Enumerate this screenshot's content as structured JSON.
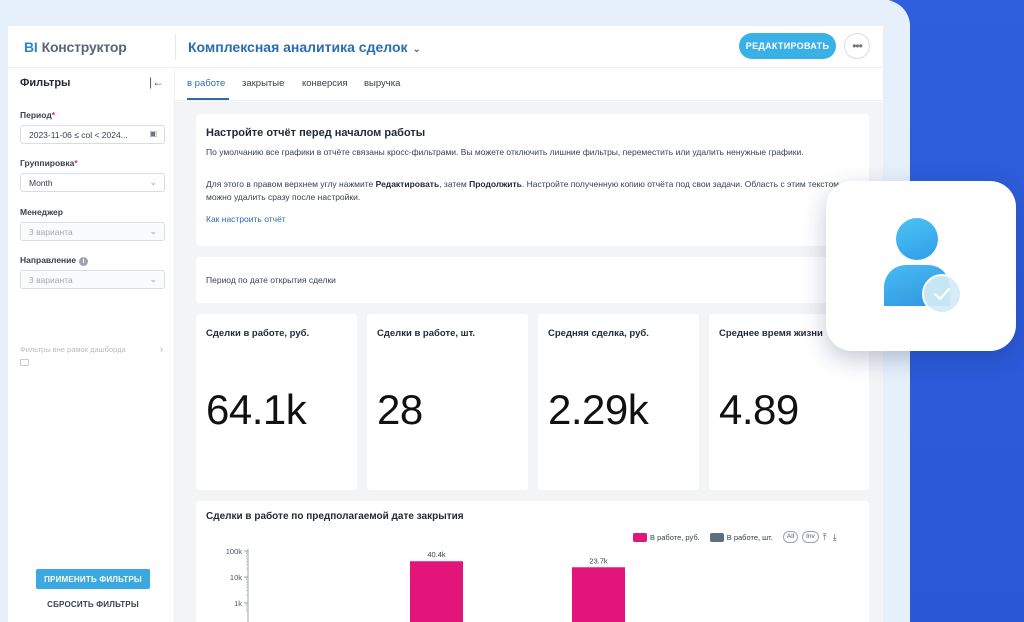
{
  "colors": {
    "accent_blue": "#2a6db0",
    "button_blue": "#39b0e6",
    "bar_magenta": "#e3157a",
    "series2_gray": "#5e6e7c",
    "background_blue": "#2f5fdc"
  },
  "header": {
    "logo_bi": "BI",
    "logo_text": "Конструктор",
    "report_title": "Комплексная аналитика сделок",
    "edit_button": "РЕДАКТИРОВАТЬ",
    "more_icon": "ellipsis-icon",
    "more_label": "•••"
  },
  "sidebar": {
    "title": "Фильтры",
    "collapse_icon": "collapse-left-icon",
    "collapse_label": "|←",
    "period": {
      "label": "Период",
      "value": "2023-11-06 ≤ col < 2024...",
      "icon": "calendar-icon"
    },
    "grouping": {
      "label": "Группировка",
      "value": "Month"
    },
    "manager": {
      "label": "Менеджер",
      "placeholder": "3 варианта"
    },
    "direction": {
      "label": "Направление",
      "placeholder": "3 варианта",
      "info": "i"
    },
    "out_of_scope": "Фильтры вне рамок дашборда",
    "apply_button": "ПРИМЕНИТЬ ФИЛЬТРЫ",
    "reset_button": "СБРОСИТЬ ФИЛЬТРЫ"
  },
  "tabs": [
    {
      "label": "в работе",
      "active": true
    },
    {
      "label": "закрытые",
      "active": false
    },
    {
      "label": "конверсия",
      "active": false
    },
    {
      "label": "выручка",
      "active": false
    }
  ],
  "intro": {
    "title": "Настройте отчёт перед началом работы",
    "p1": "По умолчанию все графики в отчёте связаны кросс-фильтрами. Вы можете отключить лишние фильтры, переместить или удалить ненужные графики.",
    "p2_a": "Для этого в правом верхнем углу нажмите ",
    "p2_b1": "Редактировать",
    "p2_c": ", затем ",
    "p2_b2": "Продолжить",
    "p2_d": ". Настройте полученную копию отчёта под свои задачи. Область с этим текстом можно удалить сразу после настройки.",
    "link": "Как настроить отчёт"
  },
  "period_card": {
    "text": "Период по дате открытия сделки"
  },
  "kpis": [
    {
      "title": "Сделки в работе, руб.",
      "value": "64.1k"
    },
    {
      "title": "Сделки в работе, шт.",
      "value": "28"
    },
    {
      "title": "Средняя сделка, руб.",
      "value": "2.29k"
    },
    {
      "title": "Среднее время жизни",
      "value": "4.89"
    }
  ],
  "chart_card": {
    "title": "Сделки в работе по предполагаемой дате закрытия",
    "legend_buttons": [
      "All",
      "Inv"
    ],
    "legend_icons": [
      "expand-icon",
      "collapse-icon"
    ]
  },
  "chart_data": {
    "type": "bar",
    "title": "Сделки в работе по предполагаемой дате закрытия",
    "yscale": "log",
    "yticks": [
      "100k",
      "10k",
      "1k"
    ],
    "ylim": [
      1000,
      100000
    ],
    "categories": [
      "",
      ""
    ],
    "series": [
      {
        "name": "В работе, руб.",
        "values": [
          40400,
          23700
        ],
        "labels": [
          "40.4k",
          "23.7k"
        ],
        "color": "#e3157a"
      },
      {
        "name": "В работе, шт.",
        "values": [],
        "color": "#5e6e7c"
      }
    ],
    "legend": "top-right"
  },
  "overlay_badge": {
    "icon": "user-verified-icon",
    "check_icon": "check-icon",
    "check_label": "✓"
  }
}
